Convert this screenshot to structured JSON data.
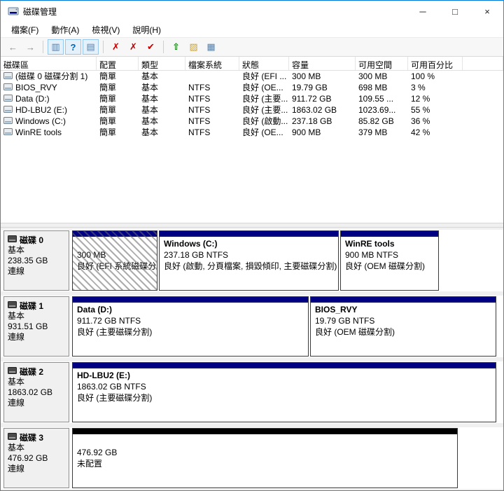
{
  "window": {
    "title": "磁碟管理",
    "minimize_glyph": "─",
    "maximize_glyph": "□",
    "close_glyph": "×"
  },
  "menu": {
    "items": [
      "檔案(F)",
      "動作(A)",
      "檢視(V)",
      "說明(H)"
    ]
  },
  "toolbar": {
    "back_glyph": "←",
    "forward_glyph": "→",
    "console_tree_glyph": "▥",
    "help_glyph": "?",
    "properties_glyph": "▤",
    "delete_glyph": "✗",
    "cross_glyph": "✗",
    "check_glyph": "✔",
    "up_arrow_glyph": "⇧",
    "folder_glyph": "▨",
    "grid_glyph": "▦"
  },
  "colors": {
    "accent": "#0078d7",
    "primary_partition_band": "#000082",
    "unallocated_band": "#000000",
    "selection_hatch": "#696969"
  },
  "table": {
    "columns": [
      "磁碟區",
      "配置",
      "類型",
      "檔案系統",
      "狀態",
      "容量",
      "可用空間",
      "可用百分比"
    ],
    "rows": [
      {
        "volume": "(磁碟 0 磁碟分割 1)",
        "layout": "簡單",
        "type": "基本",
        "filesystem": "",
        "status": "良好 (EFI ...",
        "capacity": "300 MB",
        "free_space": "300 MB",
        "percent_free": "100 %"
      },
      {
        "volume": "BIOS_RVY",
        "layout": "簡單",
        "type": "基本",
        "filesystem": "NTFS",
        "status": "良好 (OE...",
        "capacity": "19.79 GB",
        "free_space": "698 MB",
        "percent_free": "3 %"
      },
      {
        "volume": "Data (D:)",
        "layout": "簡單",
        "type": "基本",
        "filesystem": "NTFS",
        "status": "良好 (主要...",
        "capacity": "911.72 GB",
        "free_space": "109.55 ...",
        "percent_free": "12 %"
      },
      {
        "volume": "HD-LBU2 (E:)",
        "layout": "簡單",
        "type": "基本",
        "filesystem": "NTFS",
        "status": "良好 (主要...",
        "capacity": "1863.02 GB",
        "free_space": "1023.69...",
        "percent_free": "55 %"
      },
      {
        "volume": "Windows (C:)",
        "layout": "簡單",
        "type": "基本",
        "filesystem": "NTFS",
        "status": "良好 (啟動...",
        "capacity": "237.18 GB",
        "free_space": "85.82 GB",
        "percent_free": "36 %"
      },
      {
        "volume": "WinRE tools",
        "layout": "簡單",
        "type": "基本",
        "filesystem": "NTFS",
        "status": "良好 (OE...",
        "capacity": "900 MB",
        "free_space": "379 MB",
        "percent_free": "42 %"
      }
    ]
  },
  "disks": [
    {
      "name": "磁碟 0",
      "type": "基本",
      "size": "238.35 GB",
      "status": "連線",
      "partitions": [
        {
          "title": "",
          "size": "300 MB",
          "status": "良好 (EFI 系統磁碟分"
        },
        {
          "title": "Windows  (C:)",
          "size": "237.18 GB NTFS",
          "status": "良好 (啟動, 分頁檔案, 損毀傾印, 主要磁碟分割)"
        },
        {
          "title": "WinRE tools",
          "size": "900 MB NTFS",
          "status": "良好 (OEM 磁碟分割)"
        }
      ]
    },
    {
      "name": "磁碟 1",
      "type": "基本",
      "size": "931.51 GB",
      "status": "連線",
      "partitions": [
        {
          "title": "Data  (D:)",
          "size": "911.72 GB NTFS",
          "status": "良好 (主要磁碟分割)"
        },
        {
          "title": "BIOS_RVY",
          "size": "19.79 GB NTFS",
          "status": "良好 (OEM 磁碟分割)"
        }
      ]
    },
    {
      "name": "磁碟 2",
      "type": "基本",
      "size": "1863.02 GB",
      "status": "連線",
      "partitions": [
        {
          "title": "HD-LBU2  (E:)",
          "size": "1863.02 GB NTFS",
          "status": "良好 (主要磁碟分割)"
        }
      ]
    },
    {
      "name": "磁碟 3",
      "type": "基本",
      "size": "476.92 GB",
      "status": "連線",
      "partitions": [
        {
          "title": "",
          "size": "476.92 GB",
          "status": "未配置"
        }
      ]
    }
  ]
}
